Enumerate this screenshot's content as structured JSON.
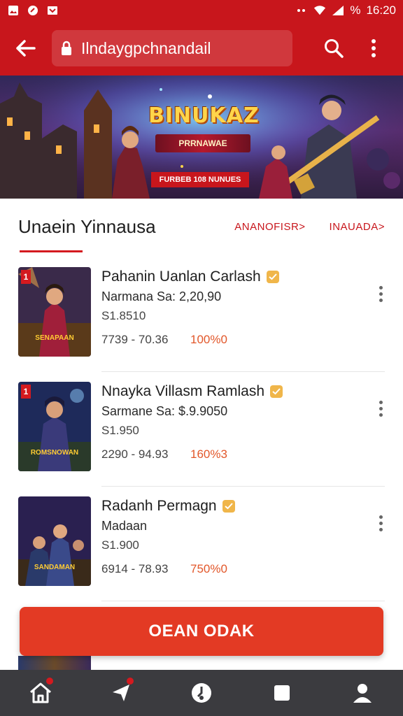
{
  "status_bar": {
    "battery": "%",
    "time": "16:20"
  },
  "toolbar": {
    "url": "Ilndaygpchnandail"
  },
  "banner": {
    "title": "BINUKAZ",
    "subtitle": "PRRNAWAE",
    "ribbon": "FURBEB 108 NUNUES"
  },
  "tabs": {
    "active_label": "Unaein Yinnausa",
    "links": [
      "ANANOFISR>",
      "INAUADA>"
    ]
  },
  "games": [
    {
      "title": "Pahanin Uanlan Carlash",
      "subtitle": "Narmana Sa:  2,20,90",
      "price": "S1.8510",
      "range": "7739 - 70.36",
      "percent": "100%0",
      "thumb_label": "SENAPAAN",
      "flag": "1"
    },
    {
      "title": "Nnayka Villasm Ramlash",
      "subtitle": "Sarmane Sa:  $.9.9050",
      "price": "S1.950",
      "range": "2290 - 94.93",
      "percent": "160%3",
      "thumb_label": "ROMSNOWAN",
      "flag": "1"
    },
    {
      "title": "Radanh Permagn",
      "subtitle": "Madaan",
      "price": "S1.900",
      "range": "6914 - 78.93",
      "percent": "750%0",
      "thumb_label": "SANDAMAN",
      "flag": ""
    }
  ],
  "cta": {
    "label": "OEAN ODAK"
  },
  "bottom_nav": [
    "home-icon",
    "send-icon",
    "globe-icon",
    "square-icon",
    "profile-icon"
  ],
  "colors": {
    "primary": "#c8161c",
    "cta": "#e33a24",
    "accent_percent": "#e2572a",
    "nav_bg": "#3b3b3f"
  }
}
